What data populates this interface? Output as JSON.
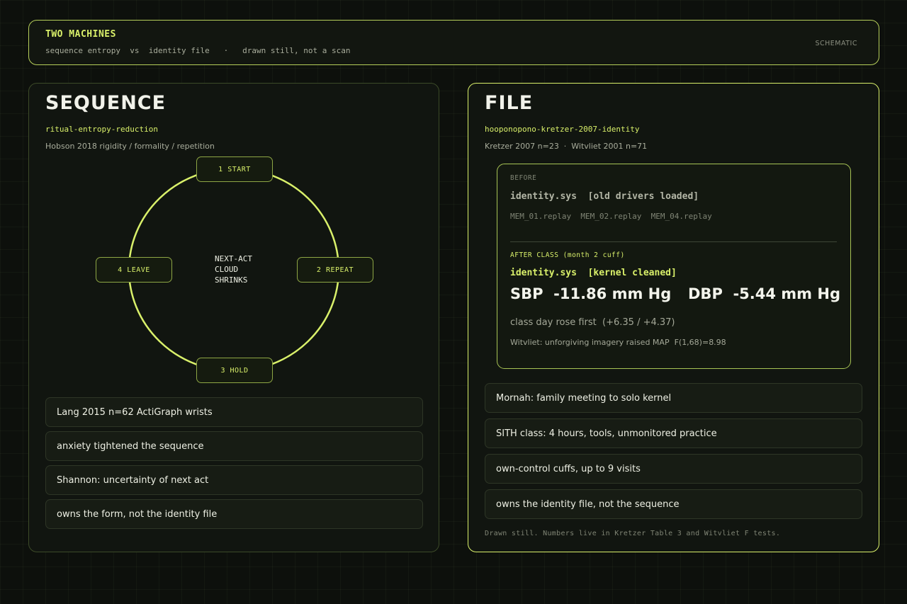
{
  "header": {
    "title": "TWO MACHINES",
    "subtitle": "sequence entropy  vs  identity file   ·   drawn still, not a scan",
    "tag": "SCHEMATIC"
  },
  "sequence": {
    "title": "SEQUENCE",
    "slug": "ritual-entropy-reduction",
    "citation": "Hobson 2018 rigidity / formality / repetition",
    "cycle": {
      "nodes": [
        "1 START",
        "2 REPEAT",
        "3 HOLD",
        "4 LEAVE"
      ],
      "center": [
        "NEXT-ACT",
        "CLOUD",
        "SHRINKS"
      ],
      "ring_color": "#d9f06a"
    },
    "notes": [
      "Lang 2015 n=62 ActiGraph wrists",
      "anxiety tightened the sequence",
      "Shannon: uncertainty of next act",
      "owns the form, not the identity file"
    ]
  },
  "file": {
    "title": "FILE",
    "slug": "hooponopono-kretzer-2007-identity",
    "citation": "Kretzer 2007 n=23  ·  Witvliet 2001 n=71",
    "before": {
      "label": "BEFORE",
      "sys": "identity.sys  [old drivers loaded]",
      "replays": "MEM_01.replay  MEM_02.replay  MEM_04.replay"
    },
    "after": {
      "label": "AFTER CLASS  (month 2 cuff)",
      "sys": "identity.sys  [kernel cleaned]",
      "sbp": "SBP  -11.86 mm Hg",
      "dbp": "DBP  -5.44 mm Hg",
      "class_day": "class day rose first  (+6.35 / +4.37)",
      "witvliet": "Witvliet: unforgiving imagery raised MAP  F(1,68)=8.98"
    },
    "notes": [
      "Mornah: family meeting to solo kernel",
      "SITH class: 4 hours, tools, unmonitored practice",
      "own-control cuffs, up to 9 visits",
      "owns the identity file, not the sequence"
    ],
    "footnote": "Drawn still. Numbers live in Kretzer Table 3 and Witvliet F tests."
  },
  "colors": {
    "accent": "#d9f06a",
    "background": "#0d100c",
    "panel": "#111510"
  }
}
